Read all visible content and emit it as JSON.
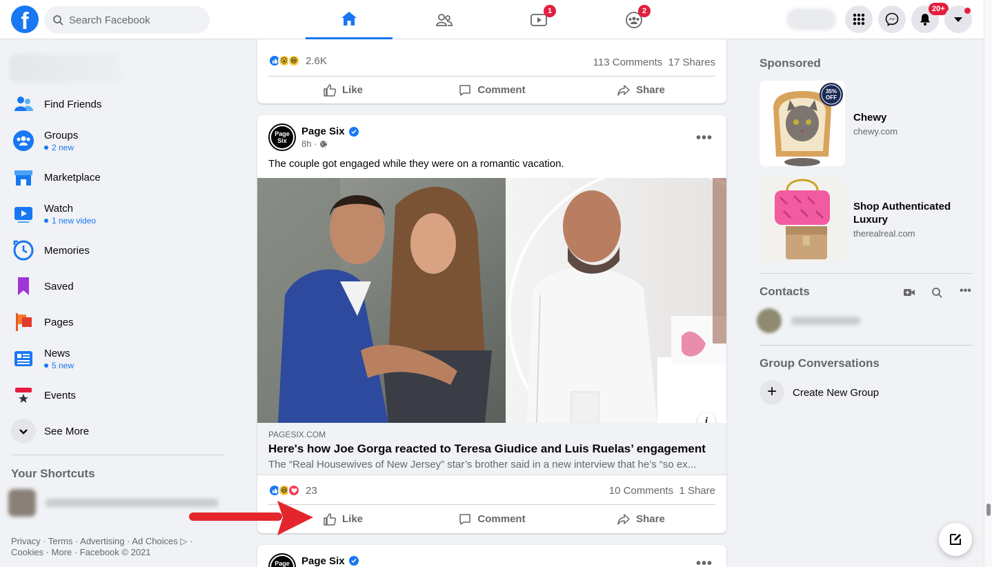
{
  "header": {
    "logo": "f",
    "search_placeholder": "Search Facebook",
    "tabs": [
      {
        "name": "home",
        "badge": ""
      },
      {
        "name": "friends",
        "badge": ""
      },
      {
        "name": "watch",
        "badge": "1"
      },
      {
        "name": "groups",
        "badge": "2"
      }
    ],
    "notifications_badge": "20+"
  },
  "sidebar": {
    "items": [
      {
        "label": "Find Friends",
        "sub": ""
      },
      {
        "label": "Groups",
        "sub": "2 new"
      },
      {
        "label": "Marketplace",
        "sub": ""
      },
      {
        "label": "Watch",
        "sub": "1 new video"
      },
      {
        "label": "Memories",
        "sub": ""
      },
      {
        "label": "Saved",
        "sub": ""
      },
      {
        "label": "Pages",
        "sub": ""
      },
      {
        "label": "News",
        "sub": "5 new"
      },
      {
        "label": "Events",
        "sub": ""
      }
    ],
    "see_more": "See More",
    "shortcuts_title": "Your Shortcuts",
    "footer": {
      "line1": "Privacy · Terms · Advertising · Ad Choices ▷ ·",
      "line2": "Cookies · More · Facebook © 2021"
    }
  },
  "feed": {
    "post1": {
      "reaction_count": "2.6K",
      "comments": "113 Comments",
      "shares": "17 Shares"
    },
    "actions": {
      "like": "Like",
      "comment": "Comment",
      "share": "Share"
    },
    "post2": {
      "author": "Page Six",
      "avatar_text": "Page Six",
      "time": "8h ·",
      "text": "The couple got engaged while they were on a romantic vacation.",
      "link_domain": "PAGESIX.COM",
      "link_title": "Here's how Joe Gorga reacted to Teresa Giudice and Luis Ruelas’ engagement",
      "link_desc": "The “Real Housewives of New Jersey” star’s brother said in a new interview that he’s “so ex...",
      "info": "i",
      "reaction_count": "23",
      "comments": "10 Comments",
      "shares": "1 Share"
    },
    "post3": {
      "author": "Page Six",
      "avatar_text": "Page Six"
    }
  },
  "right": {
    "sponsored_title": "Sponsored",
    "ads": [
      {
        "name": "Chewy",
        "domain": "chewy.com",
        "badge": "35% OFF"
      },
      {
        "name": "Shop Authenticated Luxury",
        "domain": "therealreal.com"
      }
    ],
    "contacts_title": "Contacts",
    "group_conv_title": "Group Conversations",
    "create_group": "Create New Group"
  },
  "colors": {
    "brand": "#1877f2",
    "badge": "#e41e3f",
    "arrow": "#e3262c"
  }
}
